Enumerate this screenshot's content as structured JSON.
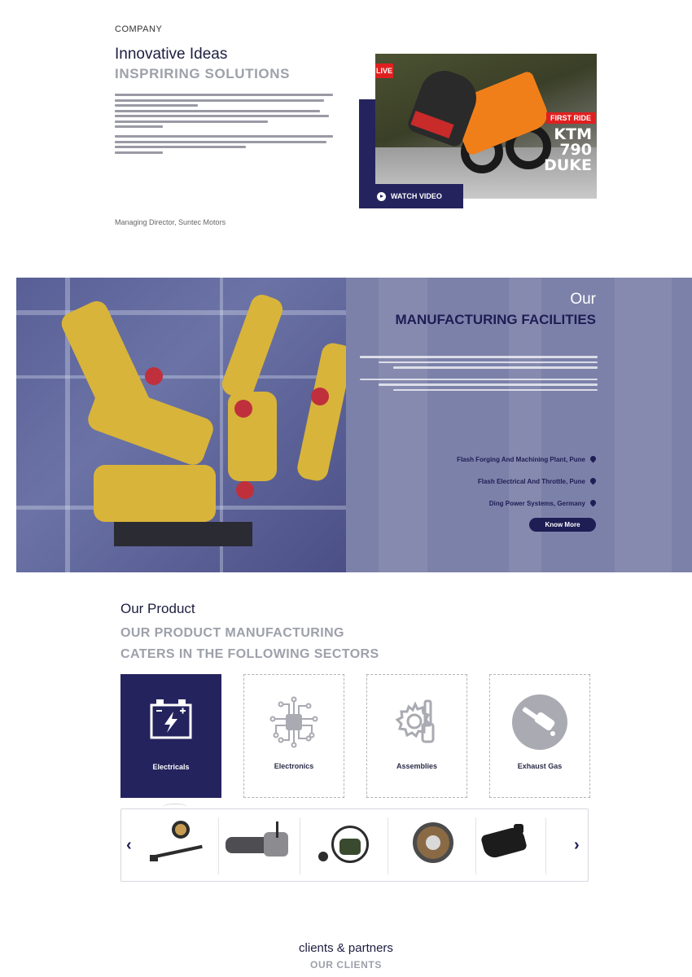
{
  "company": {
    "eyebrow": "COMPANY",
    "title": "Innovative Ideas",
    "subtitle": "INSPRIRING SOLUTIONS",
    "signature": "Managing Director, Suntec Motors"
  },
  "video": {
    "live_badge": "LIVE",
    "tag": "FIRST RIDE",
    "model": "KTM\n790\nDUKE",
    "watch_label": "WATCH VIDEO"
  },
  "manufacturing": {
    "our": "Our",
    "title": "MANUFACTURING FACILITIES",
    "facilities": [
      "Flash Forging And Machining Plant, Pune",
      "Flash Electrical And Throttle, Pune",
      "Ding Power Systems, Germany"
    ],
    "know_more": "Know More"
  },
  "products": {
    "eyebrow": "Our Product",
    "title_line1": "OUR PRODUCT MANUFACTURING",
    "title_line2": "CATERS IN THE FOLLOWING SECTORS",
    "sectors": [
      {
        "label": "Electricals",
        "icon": "battery-icon",
        "active": true
      },
      {
        "label": "Electronics",
        "icon": "circuit-chip-icon",
        "active": false
      },
      {
        "label": "Assemblies",
        "icon": "gear-wrench-icon",
        "active": false
      },
      {
        "label": "Exhaust Gas",
        "icon": "exhaust-pipe-icon",
        "active": false
      }
    ],
    "carousel": {
      "prev": "‹",
      "next": "›",
      "items": [
        "sensor-part",
        "wiper-motor",
        "throttle-sensor",
        "stator-coil",
        "black-bracket"
      ]
    }
  },
  "clients": {
    "eyebrow": "clients & partners",
    "title": "OUR CLIENTS"
  },
  "colors": {
    "navy": "#25235e",
    "grey_title": "#9ea0aa",
    "band_overlay": "#7c81a9"
  }
}
